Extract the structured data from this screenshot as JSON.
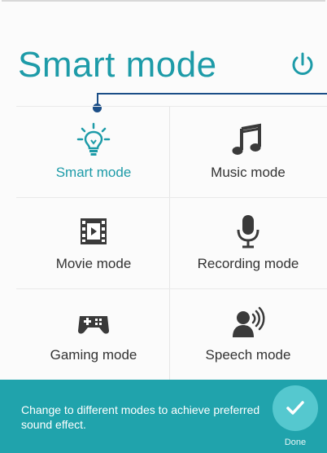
{
  "header": {
    "title": "Smart mode",
    "power_icon": "power-icon"
  },
  "modes": [
    {
      "label": "Smart mode",
      "icon": "lightbulb-icon",
      "active": true
    },
    {
      "label": "Music mode",
      "icon": "music-note-icon",
      "active": false
    },
    {
      "label": "Movie mode",
      "icon": "film-icon",
      "active": false
    },
    {
      "label": "Recording mode",
      "icon": "microphone-icon",
      "active": false
    },
    {
      "label": "Gaming mode",
      "icon": "gamepad-icon",
      "active": false
    },
    {
      "label": "Speech mode",
      "icon": "speaker-person-icon",
      "active": false
    }
  ],
  "tip": {
    "text": "Change to different modes to achieve preferred sound effect.",
    "done_label": "Done"
  },
  "colors": {
    "accent": "#1d9ba8",
    "tip_bar": "#20a3ac",
    "done_circle": "#55c8cf",
    "callout": "#1b4e87",
    "icon": "#3a3a3a"
  }
}
